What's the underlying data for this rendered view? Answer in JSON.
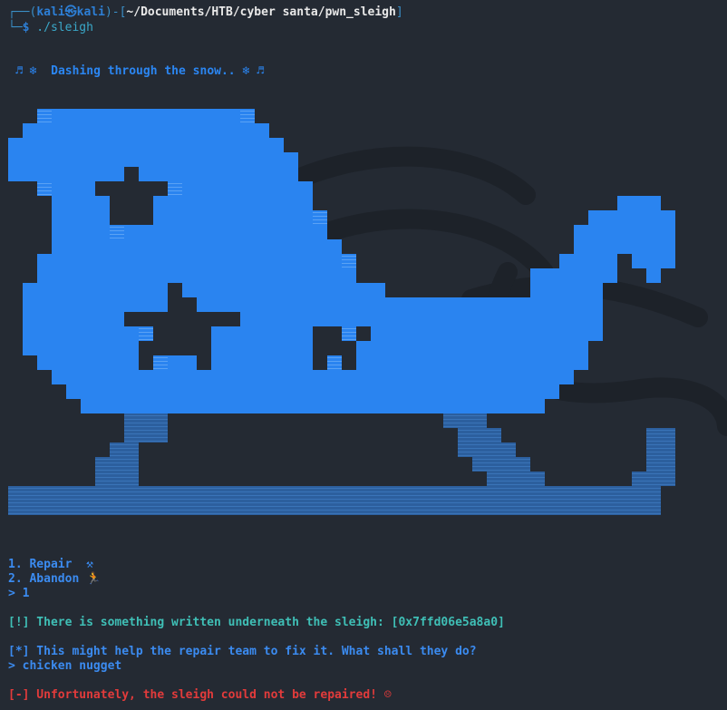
{
  "terminal": {
    "prompt_open": "┌──(",
    "user_host": "kali㉿kali",
    "prompt_mid": ")-[",
    "path": "~/Documents/HTB/cyber santa/pwn_sleigh",
    "prompt_close": "]",
    "prompt_second": "└─",
    "dollar": "$",
    "command": " ./sleigh"
  },
  "banner": "♬ ❄  Dashing through the snow.. ❄ ♬",
  "menu": {
    "option1": "1. Repair  ⚒",
    "option2": "2. Abandon 🏃",
    "choice": "> 1"
  },
  "messages": {
    "found": "[!] There is something written underneath the sleigh: [0x7ffd06e5a8a0]",
    "help": "[*] This might help the repair team to fix it. What shall they do?",
    "answer": "> chicken nugget",
    "fail": "[-] Unfortunately, the sleigh could not be repaired! ☹"
  },
  "colors": {
    "background": "#242a33",
    "sleigh_body": "#2a84f0",
    "sleigh_runner": "#2c5f9e",
    "error": "#e23b3b",
    "info": "#3fbfb6"
  }
}
